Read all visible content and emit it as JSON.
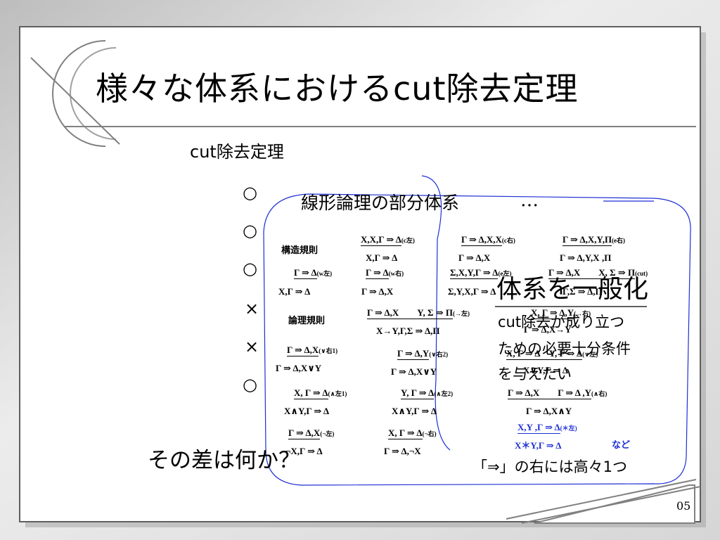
{
  "slide": {
    "title": "様々な体系におけるcut除去定理",
    "subtitle": "cut除去定理",
    "marks": [
      "○",
      "○",
      "○",
      "×",
      "×",
      "○"
    ],
    "partial_label": "線形論理の部分体系",
    "overlapped_label": "…",
    "question": "その差は何か？",
    "page_number": "05",
    "callout": {
      "headline": "体系を一般化",
      "line1": "cut除去が成り立つ",
      "line2": "ための必要十分条件",
      "line3": "を与えたい"
    },
    "footnote": "「⇒」の右には高々1つ",
    "etc": "など"
  },
  "rules": {
    "structural_label": "構造規則",
    "logical_label": "論理規則",
    "c_left": {
      "prem": "X,X,Γ ⇒ Δ",
      "concl": "X,Γ ⇒ Δ",
      "name": "(c左)"
    },
    "c_right": {
      "prem": "Γ ⇒ Δ,X,X",
      "concl": "Γ ⇒ Δ,X",
      "name": "(c右)"
    },
    "e_right": {
      "prem": "Γ ⇒ Δ,X,Y,Π",
      "concl": "Γ ⇒ Δ,Y,X ,Π",
      "name": "(e右)"
    },
    "w_left": {
      "prem": "Γ ⇒ Δ",
      "concl": "X,Γ ⇒ Δ",
      "name": "(w左)"
    },
    "w_right": {
      "prem": "Γ ⇒ Δ",
      "concl": "Γ ⇒ Δ,X",
      "name": "(w右)"
    },
    "e_left": {
      "prem": "Σ,X,Y,Γ ⇒ Δ",
      "concl": "Σ,Y,X,Γ ⇒ Δ",
      "name": "(e左)"
    },
    "cut": {
      "prem": "Γ ⇒ Δ,X　　X, Σ ⇒ Π",
      "concl": "Γ,Σ ⇒ Δ,Π",
      "name": "(cut)"
    },
    "imp_left": {
      "prem": "Γ ⇒ Δ,X　　Y, Σ ⇒ Π",
      "concl": "X→Y,Γ,Σ ⇒ Δ,Π",
      "name": "(→左)"
    },
    "imp_right": {
      "prem": "X, Γ ⇒ Δ,Y",
      "concl": "Γ ⇒ Δ,X→Y",
      "name": "(→右)"
    },
    "or_right1": {
      "prem": "Γ ⇒ Δ,X",
      "concl": "Γ ⇒ Δ,X∨Y",
      "name": "(∨右1)"
    },
    "or_right2": {
      "prem": "Γ ⇒ Δ,Y",
      "concl": "Γ ⇒ Δ,X∨Y",
      "name": "(∨右2)"
    },
    "or_left": {
      "prem": "X, Γ ⇒ Δ　Y, Γ ⇒ Δ",
      "concl": "X∨Y,Γ ⇒ Δ",
      "name": "(∨左)"
    },
    "and_left1": {
      "prem": "X,  Γ ⇒ Δ",
      "concl": "X∧Y,Γ ⇒ Δ",
      "name": "(∧左1)"
    },
    "and_left2": {
      "prem": "Y,  Γ ⇒ Δ",
      "concl": "X∧Y,Γ ⇒ Δ",
      "name": "(∧左2)"
    },
    "and_right": {
      "prem": "Γ ⇒ Δ,X　　Γ ⇒ Δ ,Y",
      "concl": "Γ ⇒ Δ,X∧Y",
      "name": "(∧右)"
    },
    "not_left": {
      "prem": "Γ ⇒ Δ,X",
      "concl": "¬X,Γ ⇒ Δ",
      "name": "(¬左)"
    },
    "not_right": {
      "prem": "X, Γ ⇒ Δ",
      "concl": "Γ ⇒ Δ,¬X",
      "name": "(¬右)"
    },
    "star_left": {
      "prem": "X,Y ,Γ ⇒ Δ",
      "concl": "X＊Y,Γ ⇒ Δ",
      "name": "(＊左)"
    }
  },
  "colors": {
    "accent": "#1d2fd4",
    "frame": "#7a7a7a",
    "card": "#ffffff"
  }
}
